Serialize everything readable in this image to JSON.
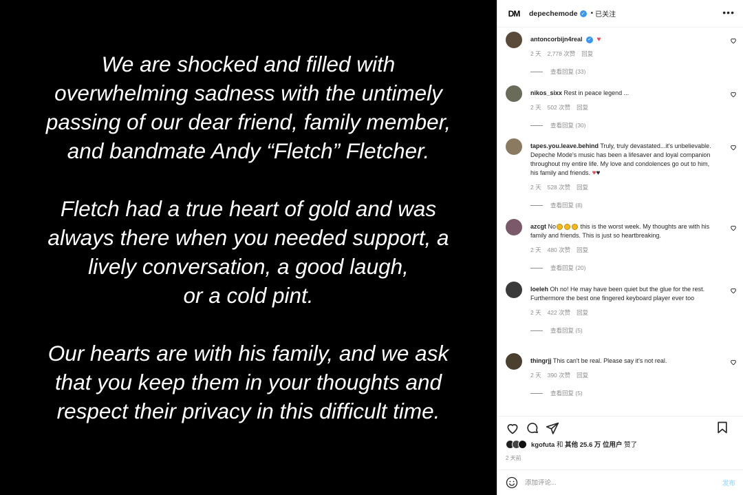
{
  "post_image": {
    "paragraphs": [
      "We are shocked and filled with\noverwhelming sadness with the untimely\npassing of our dear friend, family member,\nand bandmate Andy “Fletch” Fletcher.",
      "Fletch had a true heart of gold and was\nalways there when you needed support, a\nlively conversation, a good laugh,\nor a cold pint.",
      "Our hearts are with his family, and we ask\nthat you keep them in your thoughts and\nrespect their privacy in this difficult time."
    ]
  },
  "header": {
    "logo": "DM",
    "username": "depechemode",
    "separator": "•",
    "follow_status": "已关注",
    "more_icon": "more-horizontal-icon"
  },
  "comments": [
    {
      "username": "antoncorbijn4real",
      "verified": true,
      "text": "",
      "time": "2 天",
      "likes": "2,778 次赞",
      "reply": "回复",
      "view_replies": "查看回复 (33)",
      "avatar_color": "#5a4a3a"
    },
    {
      "username": "nikos_sixx",
      "text": "Rest in peace legend ...",
      "time": "2 天",
      "likes": "502 次赞",
      "reply": "回复",
      "view_replies": "查看回复 (30)",
      "avatar_color": "#6b6b5a"
    },
    {
      "username": "tapes.you.leave.behind",
      "text": "Truly, truly devastated...it's unbelievable. Depeche Mode's music has been a lifesaver and loyal companion throughout my entire life. My love and condolences go out to him, his family and friends.",
      "time": "2 天",
      "likes": "528 次赞",
      "reply": "回复",
      "view_replies": "查看回复 (8)",
      "avatar_color": "#8a7a60"
    },
    {
      "username": "azcgt",
      "text_before": "No",
      "text": "this is the worst week. My thoughts are with his family and friends. This is just so heartbreaking.",
      "time": "2 天",
      "likes": "480 次赞",
      "reply": "回复",
      "view_replies": "查看回复 (20)",
      "avatar_color": "#7a5a6a"
    },
    {
      "username": "loeleh",
      "text": "Oh no! He may have been quiet but the glue for the rest. Furthermore the best one fingered keyboard player ever too",
      "time": "2 天",
      "likes": "422 次赞",
      "reply": "回复",
      "view_replies": "查看回复 (5)",
      "avatar_color": "#3a3a3a"
    },
    {
      "username": "thingrjj",
      "text": "This can't be real. Please say it's not real.",
      "time": "2 天",
      "likes": "390 次赞",
      "reply": "回复",
      "view_replies": "查看回复 (5)",
      "avatar_color": "#4a4030"
    }
  ],
  "likes_summary": {
    "user": "kgofuta",
    "and": "和",
    "others": "其他 25.6 万 位用户",
    "liked": "赞了"
  },
  "post_time": "2 天前",
  "add_comment": {
    "placeholder": "添加评论...",
    "post_label": "发布"
  }
}
